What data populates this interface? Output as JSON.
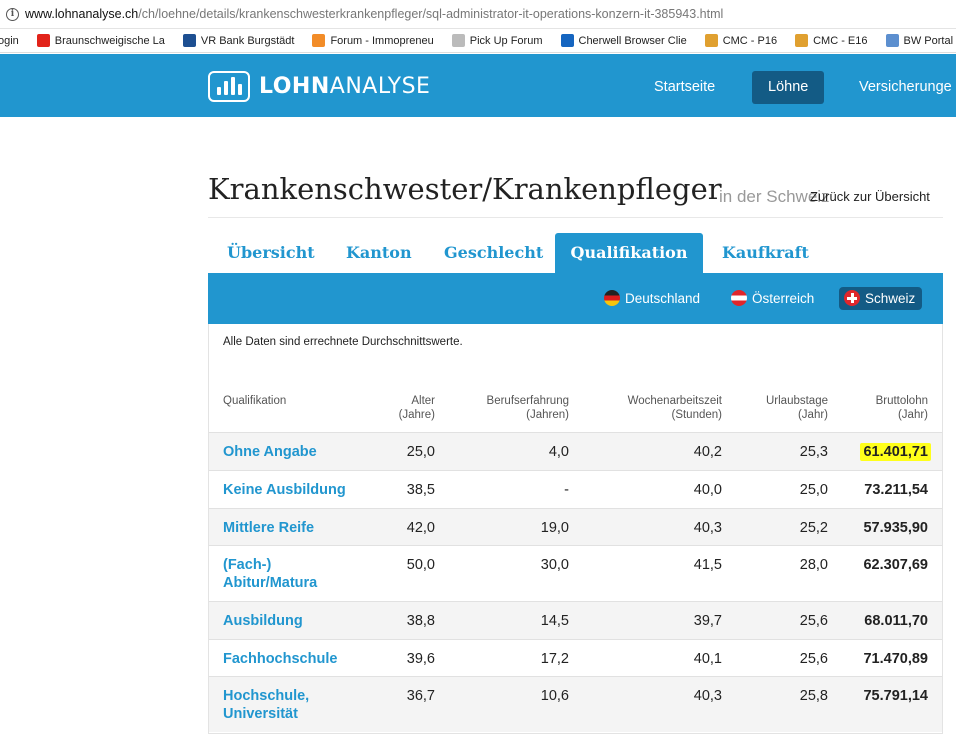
{
  "browser": {
    "url_host": "www.lohnanalyse.ch",
    "url_path": "/ch/loehne/details/krankenschwesterkrankenpfleger/sql-administrator-it-operations-konzern-it-385943.html",
    "bookmarks": [
      {
        "label": "ogin",
        "color": "#888888"
      },
      {
        "label": "Braunschweigische La",
        "color": "#e2231a"
      },
      {
        "label": "VR Bank Burgstädt",
        "color": "#1d4f91"
      },
      {
        "label": "Forum - Immopreneu",
        "color": "#f28c28"
      },
      {
        "label": "Pick Up Forum",
        "color": "#bbbbbb"
      },
      {
        "label": "Cherwell Browser Clie",
        "color": "#1565c0"
      },
      {
        "label": "CMC - P16",
        "color": "#e0a030"
      },
      {
        "label": "CMC - E16",
        "color": "#e0a030"
      },
      {
        "label": "BW Portal - Lau",
        "color": "#5c8fcf"
      }
    ]
  },
  "header": {
    "logo_bold": "LOHN",
    "logo_regular": "ANALYSE",
    "nav": [
      {
        "label": "Startseite",
        "active": false
      },
      {
        "label": "Löhne",
        "active": true
      },
      {
        "label": "Versicherunge",
        "active": false
      }
    ]
  },
  "page": {
    "title": "Krankenschwester/Krankenpfleger",
    "subtitle": "in der Schweiz",
    "back_link": "Zurück zur Übersicht"
  },
  "tabs": [
    {
      "label": "Übersicht",
      "active": false
    },
    {
      "label": "Kanton",
      "active": false
    },
    {
      "label": "Geschlecht",
      "active": false
    },
    {
      "label": "Qualifikation",
      "active": true
    },
    {
      "label": "Kaufkraft",
      "active": false
    }
  ],
  "countries": [
    {
      "label": "Deutschland",
      "active": false
    },
    {
      "label": "Österreich",
      "active": false
    },
    {
      "label": "Schweiz",
      "active": true
    }
  ],
  "table": {
    "note": "Alle Daten sind errechnete Durchschnittswerte.",
    "headers": {
      "qualifikation": "Qualifikation",
      "alter_1": "Alter",
      "alter_2": "(Jahre)",
      "beruf_1": "Berufserfahrung",
      "beruf_2": "(Jahren)",
      "woche_1": "Wochenarbeitszeit",
      "woche_2": "(Stunden)",
      "urlaub_1": "Urlaubstage",
      "urlaub_2": "(Jahr)",
      "brutto_1": "Bruttolohn",
      "brutto_2": "(Jahr)"
    },
    "rows": [
      {
        "name": "Ohne Angabe",
        "alter": "25,0",
        "beruf": "4,0",
        "woche": "40,2",
        "urlaub": "25,3",
        "brutto": "61.401,71"
      },
      {
        "name": "Keine Ausbildung",
        "alter": "38,5",
        "beruf": "-",
        "woche": "40,0",
        "urlaub": "25,0",
        "brutto": "73.211,54"
      },
      {
        "name": "Mittlere Reife",
        "alter": "42,0",
        "beruf": "19,0",
        "woche": "40,3",
        "urlaub": "25,2",
        "brutto": "57.935,90"
      },
      {
        "name": "(Fach-) Abitur/Matura",
        "alter": "50,0",
        "beruf": "30,0",
        "woche": "41,5",
        "urlaub": "28,0",
        "brutto": "62.307,69"
      },
      {
        "name": "Ausbildung",
        "alter": "38,8",
        "beruf": "14,5",
        "woche": "39,7",
        "urlaub": "25,6",
        "brutto": "68.011,70"
      },
      {
        "name": "Fachhochschule",
        "alter": "39,6",
        "beruf": "17,2",
        "woche": "40,1",
        "urlaub": "25,6",
        "brutto": "71.470,89"
      },
      {
        "name": "Hochschule, Universität",
        "alter": "36,7",
        "beruf": "10,6",
        "woche": "40,3",
        "urlaub": "25,8",
        "brutto": "75.791,14"
      }
    ],
    "highlight_color": "#ffff1a"
  },
  "colors": {
    "brand_blue": "#2196cf",
    "active_dark": "#135b85"
  }
}
